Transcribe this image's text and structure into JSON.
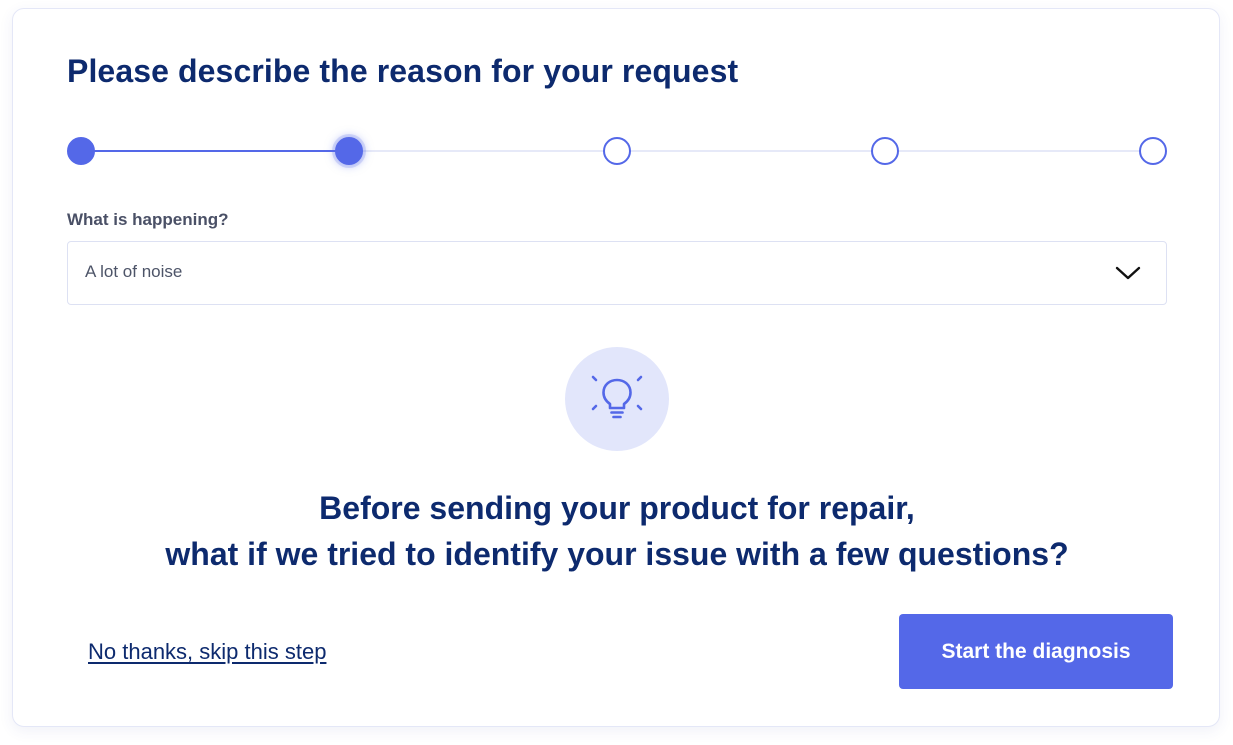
{
  "header": {
    "title": "Please describe the reason for your request"
  },
  "stepper": {
    "total_steps": 5,
    "current_step": 2
  },
  "reason_field": {
    "label": "What is happening?",
    "value": "A lot of noise"
  },
  "icons": {
    "tip": "lightbulb-icon",
    "dropdown": "chevron-down-icon"
  },
  "message": {
    "line1": "Before sending your product for repair,",
    "line2": "what if we tried to identify your issue with a few questions?"
  },
  "actions": {
    "skip_label": "No thanks, skip this step",
    "start_label": "Start the diagnosis"
  },
  "colors": {
    "primary": "#5468e8",
    "heading": "#0d2a6e",
    "icon_bg": "#e2e6fb"
  }
}
